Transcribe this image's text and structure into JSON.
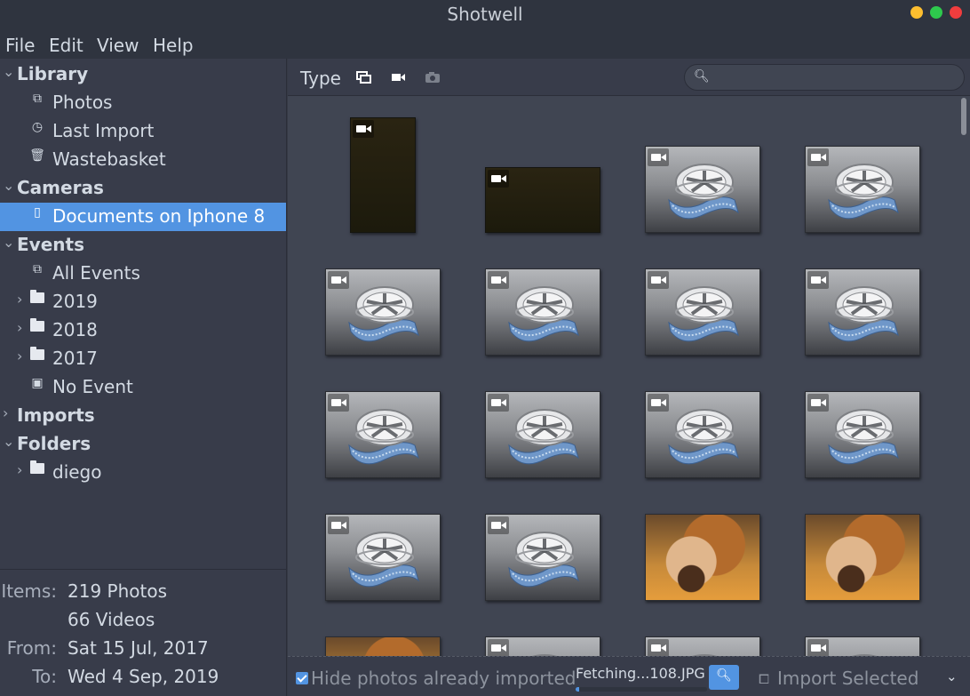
{
  "window": {
    "title": "Shotwell"
  },
  "menu": [
    "File",
    "Edit",
    "View",
    "Help"
  ],
  "sidebar": {
    "library": {
      "label": "Library",
      "items": [
        "Photos",
        "Last Import",
        "Wastebasket"
      ]
    },
    "cameras": {
      "label": "Cameras",
      "items": [
        "Documents on Iphone 8"
      ]
    },
    "events": {
      "label": "Events",
      "items": [
        "All Events",
        "2019",
        "2018",
        "2017",
        "No Event"
      ]
    },
    "imports": {
      "label": "Imports"
    },
    "folders": {
      "label": "Folders",
      "items": [
        "diego"
      ]
    }
  },
  "info": {
    "items_label": "Items:",
    "photos": "219 Photos",
    "videos": "66 Videos",
    "from_label": "From:",
    "from": "Sat 15 Jul, 2017",
    "to_label": "To:",
    "to": "Wed 4 Sep, 2019"
  },
  "toolbar": {
    "type_label": "Type",
    "search_value": ""
  },
  "bottom": {
    "hide_imported": "Hide photos already imported",
    "fetching": "Fetching...108.JPG",
    "progress": 0.03,
    "import_selected": "Import Selected"
  },
  "thumbnails": [
    "dark-vertical-video",
    "dark-wide-video",
    "video-placeholder",
    "video-placeholder",
    "video-placeholder",
    "video-placeholder",
    "video-placeholder",
    "video-placeholder",
    "video-placeholder",
    "video-placeholder",
    "video-placeholder",
    "video-placeholder",
    "video-placeholder",
    "video-placeholder",
    "dog-photo",
    "dog-photo",
    "dog-photo",
    "video-placeholder",
    "video-placeholder",
    "video-placeholder"
  ],
  "colors": {
    "accent": "#5294e2",
    "bg": "#404552",
    "sidebar": "#383c4a"
  }
}
